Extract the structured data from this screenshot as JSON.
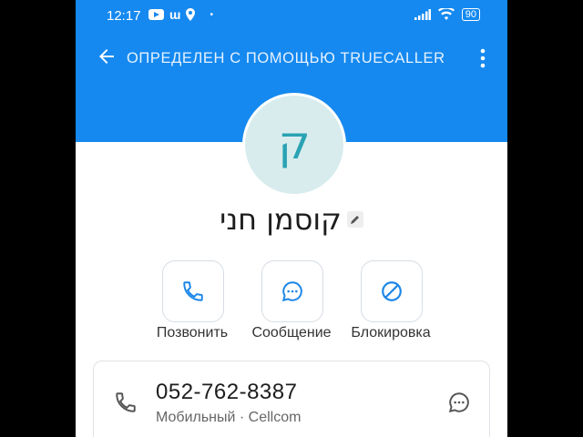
{
  "status_bar": {
    "time": "12:17",
    "battery": "90"
  },
  "header": {
    "title": "ОПРЕДЕЛЕН С ПОМОЩЬЮ TRUECALLER"
  },
  "contact": {
    "avatar_letter": "ק",
    "name": "קוסמן חני"
  },
  "actions": {
    "call_label": "Позвонить",
    "message_label": "Сообщение",
    "block_label": "Блокировка"
  },
  "phone_card": {
    "number": "052-762-8387",
    "subtitle": "Мобильный · Cellcom"
  },
  "colors": {
    "header_blue": "#1589f0",
    "accent_blue": "#1a86e8",
    "avatar_bg": "#d8ecee",
    "avatar_letter": "#2aa3b3"
  }
}
